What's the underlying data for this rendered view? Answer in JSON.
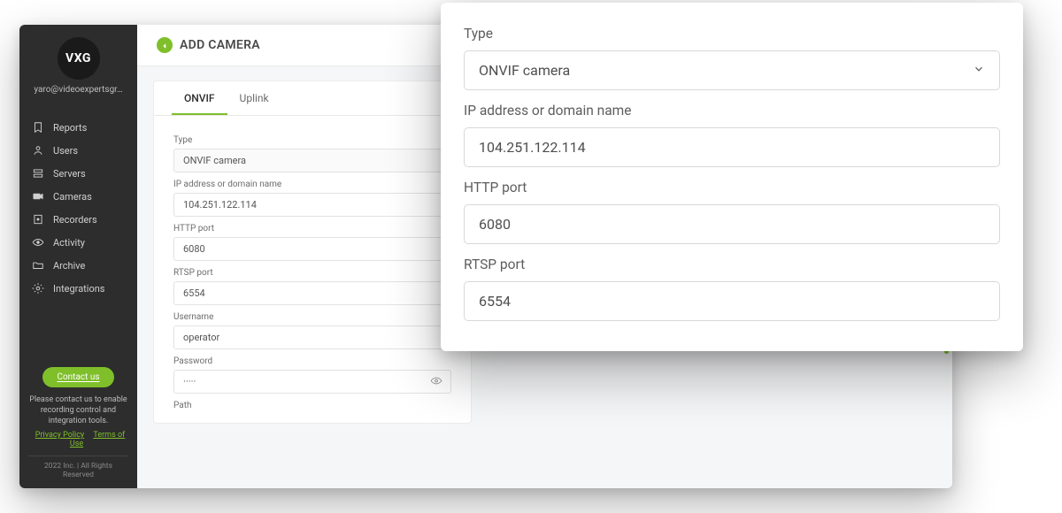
{
  "brand": {
    "logo": "VXG"
  },
  "user": {
    "email": "yaro@videoexpertsgr…"
  },
  "sidebar": {
    "items": [
      {
        "label": "Reports",
        "icon": "bookmark"
      },
      {
        "label": "Users",
        "icon": "user"
      },
      {
        "label": "Servers",
        "icon": "server"
      },
      {
        "label": "Cameras",
        "icon": "camera"
      },
      {
        "label": "Recorders",
        "icon": "recorder"
      },
      {
        "label": "Activity",
        "icon": "eye"
      },
      {
        "label": "Archive",
        "icon": "folder"
      },
      {
        "label": "Integrations",
        "icon": "cog"
      }
    ],
    "contact_button": "Contact us",
    "footer_note": "Please contact us to enable recording control and integration tools.",
    "privacy": "Privacy Policy",
    "terms": "Terms of Use",
    "copyright": "2022 Inc. | All Rights Reserved"
  },
  "page": {
    "title": "ADD CAMERA"
  },
  "tabs": {
    "onvif": "ONVIF",
    "uplink": "Uplink"
  },
  "form_labels": {
    "type": "Type",
    "ip": "IP address or domain name",
    "http": "HTTP port",
    "rtsp": "RTSP port",
    "username": "Username",
    "password": "Password",
    "path": "Path"
  },
  "form_values": {
    "type": "ONVIF camera",
    "ip": "104.251.122.114",
    "http": "6080",
    "rtsp": "6554",
    "username": "operator",
    "password": "·····"
  },
  "fg": {
    "type_label": "Type",
    "type_value": "ONVIF camera",
    "ip_label": "IP address or domain name",
    "ip_value": "104.251.122.114",
    "http_label": "HTTP port",
    "http_value": "6080",
    "rtsp_label": "RTSP port",
    "rtsp_value": "6554"
  }
}
